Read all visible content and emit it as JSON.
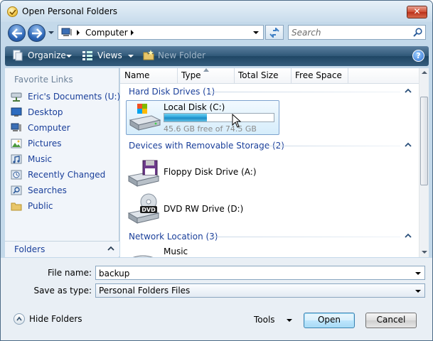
{
  "window": {
    "title": "Open Personal Folders",
    "close_glyph": "✕"
  },
  "address": {
    "path": "Computer",
    "search_placeholder": "Search"
  },
  "toolbar": {
    "organize": "Organize",
    "views": "Views",
    "new_folder": "New Folder",
    "help_glyph": "?"
  },
  "sidebar": {
    "title": "Favorite Links",
    "items": [
      {
        "label": "Eric's Documents (U:)",
        "icon": "network-drive-icon"
      },
      {
        "label": "Desktop",
        "icon": "desktop-icon"
      },
      {
        "label": "Computer",
        "icon": "computer-icon"
      },
      {
        "label": "Pictures",
        "icon": "pictures-icon"
      },
      {
        "label": "Music",
        "icon": "music-icon"
      },
      {
        "label": "Recently Changed",
        "icon": "recent-icon"
      },
      {
        "label": "Searches",
        "icon": "searches-icon"
      },
      {
        "label": "Public",
        "icon": "public-folder-icon"
      }
    ],
    "folders_label": "Folders"
  },
  "columns": [
    "Name",
    "Type",
    "Total Size",
    "Free Space"
  ],
  "groups": {
    "hard_disk": "Hard Disk Drives (1)",
    "removable": "Devices with Removable Storage (2)",
    "network": "Network Location (3)"
  },
  "drives": {
    "local": {
      "name": "Local Disk (C:)",
      "free_text": "45.6 GB free of 74.5 GB",
      "used_fraction": 0.388
    },
    "floppy": {
      "name": "Floppy Disk Drive (A:)"
    },
    "dvd": {
      "name": "DVD RW Drive (D:)",
      "badge": "DVD"
    },
    "network_first": {
      "name": "Music"
    }
  },
  "form": {
    "file_name_label": "File name:",
    "file_name_value": "backup",
    "save_type_label": "Save as type:",
    "save_type_value": "Personal Folders Files"
  },
  "footer": {
    "hide_folders": "Hide Folders",
    "tools": "Tools",
    "open": "Open",
    "cancel": "Cancel"
  },
  "colors": {
    "accent_link": "#1a3f9a",
    "toolbar": "#2f5878",
    "usage_fill": "#26a0da"
  }
}
